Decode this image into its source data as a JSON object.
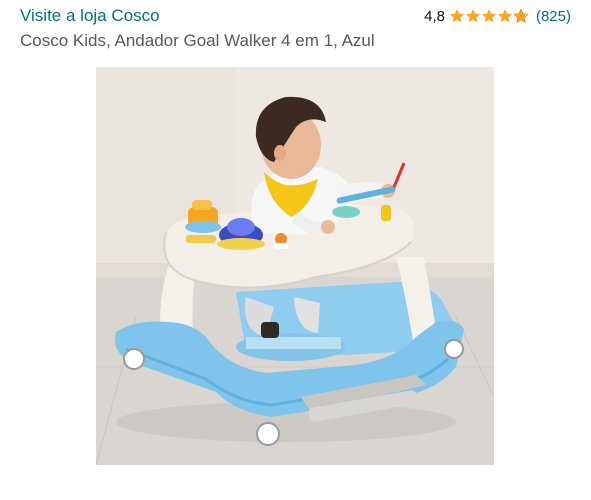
{
  "store": {
    "label": "Visite a loja Cosco"
  },
  "rating": {
    "value": "4,8",
    "stars": 4.8,
    "star_color": "#ffa41c",
    "count": "(825)"
  },
  "product": {
    "title": "Cosco Kids, Andador Goal Walker 4 em 1, Azul",
    "image_icon": "baby-walker-photo"
  },
  "colors": {
    "link": "#007185",
    "secondary_text": "#565959",
    "walker_blue": "#7fc4ea",
    "tray_white": "#f3efe8"
  }
}
